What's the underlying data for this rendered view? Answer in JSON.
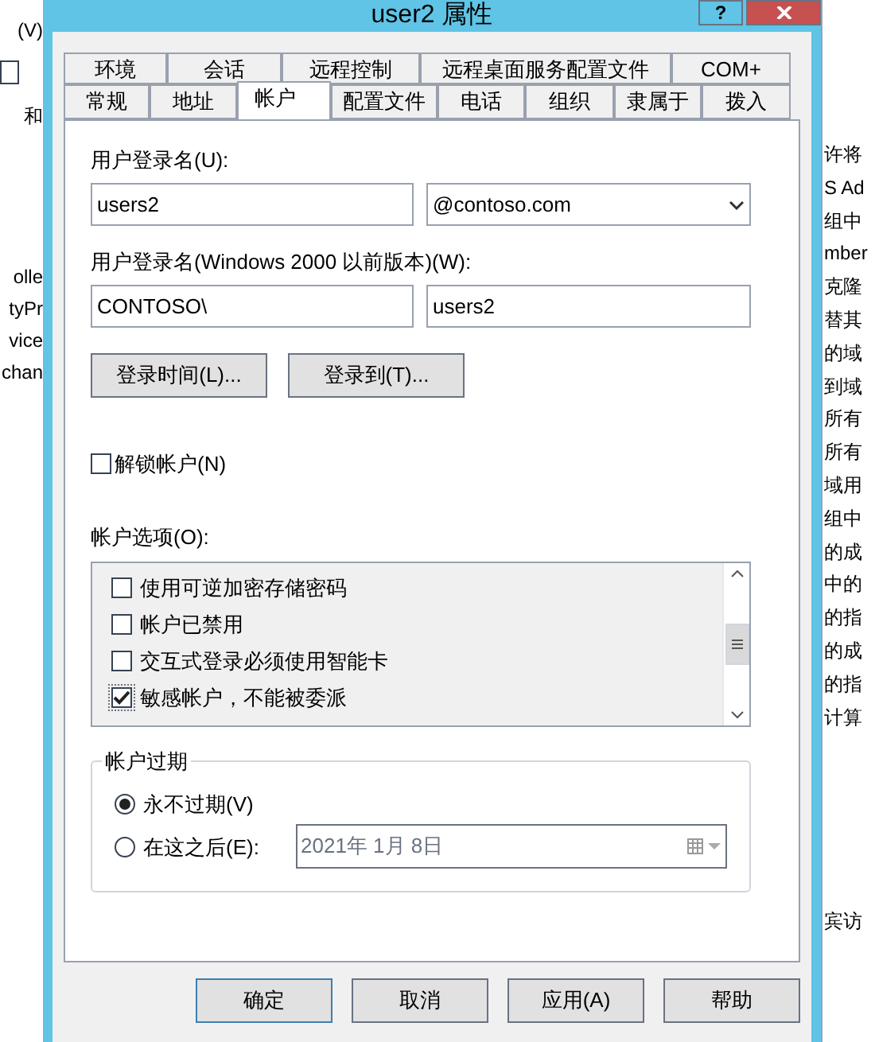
{
  "background": {
    "left_texts": [
      "(V)",
      "和",
      "olle",
      "tyPr",
      "vice",
      "chan"
    ],
    "right_texts": [
      "许将",
      "S Ad",
      "组中",
      "mber",
      "克隆",
      "替其",
      "的域",
      "到域",
      "所有",
      "所有",
      "域用",
      "组中",
      "的成",
      "中的",
      "的指",
      "的成",
      "的指",
      "计算"
    ],
    "right_bottom_text": "宾访"
  },
  "window": {
    "title": "user2 属性",
    "help_button": "?"
  },
  "tabs_row1": [
    {
      "label": "环境",
      "selected": false
    },
    {
      "label": "会话",
      "selected": false
    },
    {
      "label": "远程控制",
      "selected": false
    },
    {
      "label": "远程桌面服务配置文件",
      "selected": false
    },
    {
      "label": "COM+",
      "selected": false
    }
  ],
  "tabs_row2": [
    {
      "label": "常规",
      "selected": false
    },
    {
      "label": "地址",
      "selected": false
    },
    {
      "label": "帐户",
      "selected": true
    },
    {
      "label": "配置文件",
      "selected": false
    },
    {
      "label": "电话",
      "selected": false
    },
    {
      "label": "组织",
      "selected": false
    },
    {
      "label": "隶属于",
      "selected": false
    },
    {
      "label": "拨入",
      "selected": false
    }
  ],
  "logon_name": {
    "label": "用户登录名(U):",
    "value": "users2",
    "domain": "@contoso.com"
  },
  "pre2000_name": {
    "label": "用户登录名(Windows 2000 以前版本)(W):",
    "domain": "CONTOSO\\",
    "value": "users2"
  },
  "logon_buttons": [
    "登录时间(L)...",
    "登录到(T)..."
  ],
  "unlock": {
    "label": "解锁帐户(N)",
    "checked": false
  },
  "account_options": {
    "label": "帐户选项(O):",
    "items": [
      {
        "label": "使用可逆加密存储密码",
        "checked": false
      },
      {
        "label": "帐户已禁用",
        "checked": false
      },
      {
        "label": "交互式登录必须使用智能卡",
        "checked": false
      },
      {
        "label": "敏感帐户，不能被委派",
        "checked": true
      }
    ]
  },
  "expiry": {
    "title": "帐户过期",
    "options": [
      {
        "label": "永不过期(V)",
        "selected": true
      },
      {
        "label": "在这之后(E):",
        "selected": false
      }
    ],
    "date": "2021年  1月  8日"
  },
  "buttons": [
    "确定",
    "取消",
    "应用(A)",
    "帮助"
  ]
}
